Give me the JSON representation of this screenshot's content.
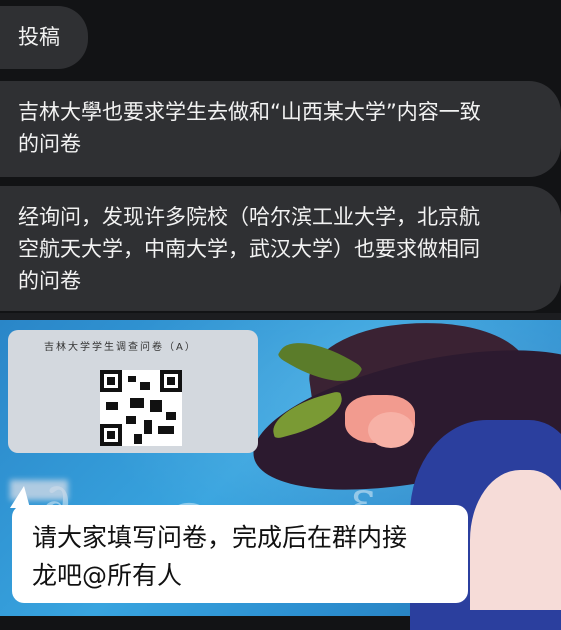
{
  "messages": [
    {
      "lines": [
        "投稿"
      ]
    },
    {
      "lines": [
        "吉林大學也要求学生去做和“山西某大学”内容一致",
        "的问卷"
      ]
    },
    {
      "lines": [
        "经询问，发现许多院校（哈尔滨工业大学，北京航",
        "空航天大学，中南大学，武汉大学）也要求做相同",
        "的问卷"
      ]
    }
  ],
  "image": {
    "card_title": "吉林大学学生调查问卷（A）",
    "speech_lines": [
      "请大家填写问卷，完成后在群内接",
      "龙吧@所有人"
    ]
  },
  "colors": {
    "background": "#121315",
    "bubble": "#2f3033",
    "bubble_text": "#f2f2f2"
  }
}
